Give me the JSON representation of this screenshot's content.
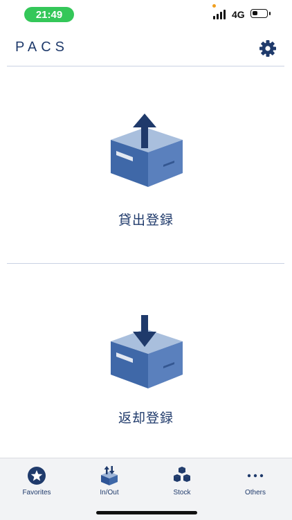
{
  "status_bar": {
    "time": "21:49",
    "network": "4G",
    "battery_level": 0.35
  },
  "header": {
    "logo": "PACS",
    "settings_icon": "gear-icon"
  },
  "actions": [
    {
      "label": "貸出登録",
      "icon": "box-arrow-up-icon"
    },
    {
      "label": "返却登録",
      "icon": "box-arrow-down-icon"
    }
  ],
  "tabs": [
    {
      "label": "Favorites",
      "icon": "star-icon"
    },
    {
      "label": "In/Out",
      "icon": "in-out-icon"
    },
    {
      "label": "Stock",
      "icon": "stock-boxes-icon"
    },
    {
      "label": "Others",
      "icon": "more-dots-icon"
    }
  ],
  "colors": {
    "primary": "#1f3a6b",
    "box_dark": "#3f68a8",
    "box_light": "#9fb6d8",
    "status_green": "#34c759"
  }
}
